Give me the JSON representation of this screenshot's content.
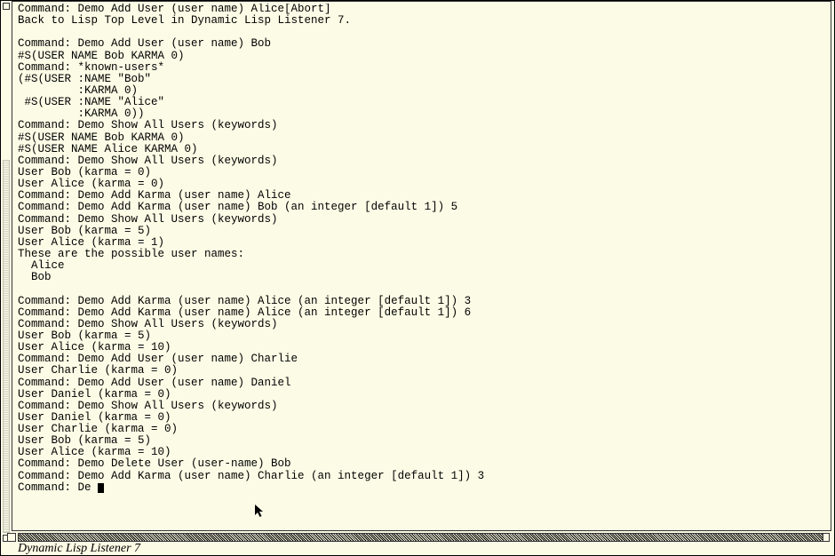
{
  "terminal": {
    "lines": [
      "Command: Demo Add User (user name) Alice[Abort]",
      "Back to Lisp Top Level in Dynamic Lisp Listener 7.",
      "",
      "Command: Demo Add User (user name) Bob",
      "#S(USER NAME Bob KARMA 0)",
      "Command: *known-users*",
      "(#S(USER :NAME \"Bob\"",
      "         :KARMA 0)",
      " #S(USER :NAME \"Alice\"",
      "         :KARMA 0))",
      "Command: Demo Show All Users (keywords)",
      "#S(USER NAME Bob KARMA 0)",
      "#S(USER NAME Alice KARMA 0)",
      "Command: Demo Show All Users (keywords)",
      "User Bob (karma = 0)",
      "User Alice (karma = 0)",
      "Command: Demo Add Karma (user name) Alice",
      "Command: Demo Add Karma (user name) Bob (an integer [default 1]) 5",
      "Command: Demo Show All Users (keywords)",
      "User Bob (karma = 5)",
      "User Alice (karma = 1)",
      "These are the possible user names:",
      "  Alice",
      "  Bob",
      "",
      "Command: Demo Add Karma (user name) Alice (an integer [default 1]) 3",
      "Command: Demo Add Karma (user name) Alice (an integer [default 1]) 6",
      "Command: Demo Show All Users (keywords)",
      "User Bob (karma = 5)",
      "User Alice (karma = 10)",
      "Command: Demo Add User (user name) Charlie",
      "User Charlie (karma = 0)",
      "Command: Demo Add User (user name) Daniel",
      "User Daniel (karma = 0)",
      "Command: Demo Show All Users (keywords)",
      "User Daniel (karma = 0)",
      "User Charlie (karma = 0)",
      "User Bob (karma = 5)",
      "User Alice (karma = 10)",
      "Command: Demo Delete User (user-name) Bob",
      "Command: Demo Add Karma (user name) Charlie (an integer [default 1]) 3"
    ],
    "prompt_line_prefix": "Command: De "
  },
  "statusbar": {
    "title": "Dynamic Lisp Listener 7"
  }
}
